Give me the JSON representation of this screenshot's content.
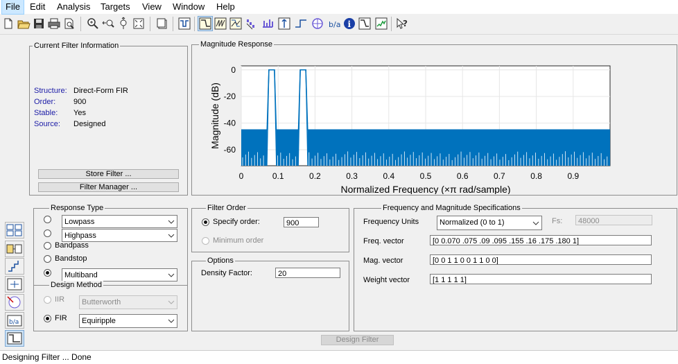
{
  "menu": [
    "File",
    "Edit",
    "Analysis",
    "Targets",
    "View",
    "Window",
    "Help"
  ],
  "toolbar": {
    "icons": [
      "new-icon",
      "open-icon",
      "save-icon",
      "print-icon",
      "print-preview-icon",
      "zoom-in-icon",
      "zoom-x-icon",
      "zoom-y-icon",
      "full-view-icon",
      "new-figure-icon",
      "filter-designer-icon",
      "magnitude-response-icon",
      "phase-response-icon",
      "magnitude-phase-icon",
      "group-delay-icon",
      "phase-delay-icon",
      "impulse-response-icon",
      "step-response-icon",
      "pole-zero-icon",
      "filter-coefficients-icon",
      "filter-info-icon",
      "magnitude-estimate-icon",
      "round-off-noise-icon",
      "whats-this-icon"
    ]
  },
  "filter_info": {
    "title": "Current Filter Information",
    "rows": [
      {
        "label": "Structure:",
        "value": "Direct-Form FIR"
      },
      {
        "label": "Order:",
        "value": "900"
      },
      {
        "label": "Stable:",
        "value": "Yes"
      },
      {
        "label": "Source:",
        "value": "Designed"
      }
    ],
    "store_button": "Store Filter ...",
    "manager_button": "Filter Manager ..."
  },
  "magnitude_panel": {
    "title": "Magnitude Response"
  },
  "chart_data": {
    "type": "line",
    "title": "",
    "xlabel": "Normalized Frequency (×π rad/sample)",
    "ylabel": "Magnitude (dB)",
    "xlim": [
      0,
      1
    ],
    "ylim": [
      -72,
      3
    ],
    "xticks": [
      "0",
      "0.1",
      "0.2",
      "0.3",
      "0.4",
      "0.5",
      "0.6",
      "0.7",
      "0.8",
      "0.9"
    ],
    "yticks": [
      "0",
      "-20",
      "-40",
      "-60"
    ],
    "grid": true,
    "series": [
      {
        "color": "#0072bd",
        "x": [
          0,
          0.07,
          0.075,
          0.09,
          0.095,
          0.155,
          0.16,
          0.175,
          0.18,
          1
        ],
        "y": [
          -45,
          -45,
          0,
          0,
          -45,
          -45,
          0,
          0,
          -45,
          -45
        ]
      }
    ]
  },
  "response_type": {
    "title": "Response Type",
    "lowpass": "Lowpass",
    "highpass": "Highpass",
    "bandpass": "Bandpass",
    "bandstop": "Bandstop",
    "multiband": "Multiband",
    "selected": "Multiband"
  },
  "design_method": {
    "title": "Design Method",
    "iir_label": "IIR",
    "iir_value": "Butterworth",
    "fir_label": "FIR",
    "fir_value": "Equiripple",
    "selected": "FIR"
  },
  "filter_order": {
    "title": "Filter Order",
    "specify_label": "Specify order:",
    "specify_value": "900",
    "minimum_label": "Minimum order"
  },
  "options": {
    "title": "Options",
    "density_label": "Density Factor:",
    "density_value": "20"
  },
  "freq_mag_specs": {
    "title": "Frequency and Magnitude Specifications",
    "freq_units_label": "Frequency Units",
    "freq_units_value": "Normalized (0 to 1)",
    "fs_label": "Fs:",
    "fs_value": "48000",
    "freq_vector_label": "Freq. vector",
    "freq_vector_value": "[0 0.070 .075 .09 .095 .155 .16 .175 .180 1]",
    "mag_vector_label": "Mag. vector",
    "mag_vector_value": "[0 0 1 1 0 0 1 1 0 0]",
    "weight_vector_label": "Weight vector",
    "weight_vector_value": "[1 1 1 1 1]"
  },
  "design_button": "Design Filter",
  "status": "Designing Filter ... Done"
}
